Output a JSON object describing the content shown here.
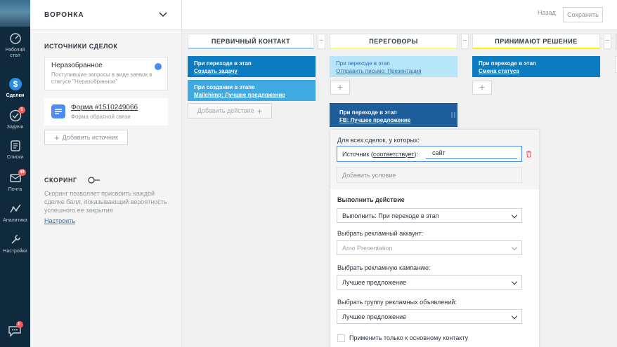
{
  "nav": {
    "items": [
      {
        "label": "Рабочий стол",
        "icon": "dashboard-icon"
      },
      {
        "label": "Сделки",
        "icon": "deals-icon",
        "active": true
      },
      {
        "label": "Задачи",
        "icon": "tasks-icon",
        "badge": "5"
      },
      {
        "label": "Списки",
        "icon": "lists-icon"
      },
      {
        "label": "Почта",
        "icon": "mail-icon",
        "badge": "49"
      },
      {
        "label": "Аналитика",
        "icon": "analytics-icon"
      },
      {
        "label": "Настройки",
        "icon": "settings-icon"
      }
    ],
    "chat_badge": "1"
  },
  "left_panel": {
    "title": "ВОРОНКА",
    "sources_title": "ИСТОЧНИКИ СДЕЛОК",
    "source_unsorted": {
      "name": "Неразобранное",
      "desc": "Поступившие запросы в виде заявок в статусе \"Неразобранное\""
    },
    "source_form": {
      "name": "Форма #1510249066",
      "desc": "Форма обратной связи"
    },
    "add_source_label": "Добавить источник",
    "scoring_title": "СКОРИНГ",
    "scoring_desc": "Скоринг позволяет присвоить каждой сделке балл, показывающий вероятность успешного ее закрытия",
    "scoring_link": "Настроить"
  },
  "header": {
    "back_label": "Назад",
    "save_label": "Сохранить"
  },
  "columns": [
    {
      "title": "ПЕРВИЧНЫЙ КОНТАКТ",
      "color": "#99ccff"
    },
    {
      "title": "ПЕРЕГОВОРЫ",
      "color": "#fffd7f"
    },
    {
      "title": "ПРИНИМАЮТ РЕШЕНИЕ",
      "color": "#fff000"
    }
  ],
  "col1": {
    "trigger1": {
      "line1": "При переходе в этап",
      "line2": "Создать задачу"
    },
    "trigger2": {
      "line1": "При создании в этапе",
      "line2": "Mailchimp: Лучшее предложение"
    },
    "add_action_label": "Добавить действие"
  },
  "col2": {
    "trigger1": {
      "line1": "При переходе в этап",
      "line2": "Отправить письмо: Презентация"
    },
    "trigger_fb": {
      "line1": "При переходе в этап",
      "line2": "FB: Лучшее предложение"
    }
  },
  "col3": {
    "trigger1": {
      "line1": "При переходе в этап",
      "line2": "Смена статуса"
    }
  },
  "edit_panel": {
    "for_all_label": "Для всех сделок, у которых:",
    "condition_prefix": "Источник (",
    "condition_link": "соответствует",
    "condition_suffix": "):",
    "condition_value": "сайт",
    "add_condition_label": "Добавить условие",
    "perform_title": "Выполнить действие",
    "perform_value": "Выполнить: При переходе в этап",
    "ad_account_label": "Выбрать рекламный аккаунт:",
    "ad_account_value": "Amo Presentation",
    "campaign_label": "Выбрать рекламную кампанию:",
    "campaign_value": "Лучшее предложение",
    "adgroup_label": "Выбрать группу рекламных объявлений:",
    "adgroup_value": "Лучшее предложение",
    "main_contact_label": "Применить только к основному контакту"
  }
}
